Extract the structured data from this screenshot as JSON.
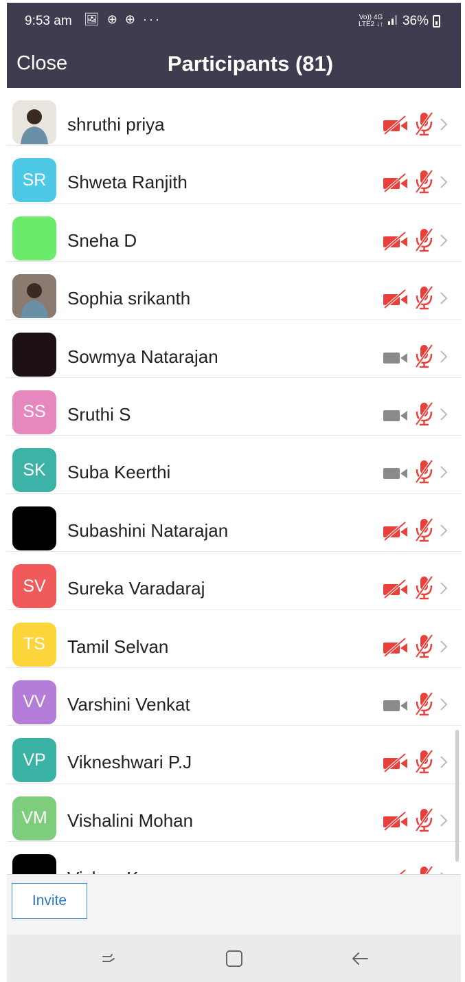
{
  "status_bar": {
    "time": "9:53 am",
    "left_icons": "🖼 ⊕ ⊕ ···",
    "network_top": "Vo)) 4G",
    "network_bottom": "LTE2 ↓↑",
    "battery": "36%"
  },
  "header": {
    "close_label": "Close",
    "title": "Participants (81)"
  },
  "colors": {
    "header_bg": "#3d3d4f",
    "muted_red": "#e8413c",
    "video_on_gray": "#8a8a8a",
    "invite_blue": "#2b73c3"
  },
  "participants": [
    {
      "name": "shruthi priya",
      "initials": "",
      "avatar_color": "#e9e6e0",
      "photo": true,
      "video": "off",
      "audio": "muted"
    },
    {
      "name": "Shweta Ranjith",
      "initials": "SR",
      "avatar_color": "#4ec9e5",
      "video": "off",
      "audio": "muted"
    },
    {
      "name": "Sneha D",
      "initials": "",
      "avatar_color": "#6cea6c",
      "video": "off",
      "audio": "muted"
    },
    {
      "name": "Sophia srikanth",
      "initials": "",
      "avatar_color": "#8a7a70",
      "photo": true,
      "video": "off",
      "audio": "muted"
    },
    {
      "name": "Sowmya Natarajan",
      "initials": "",
      "avatar_color": "#1c1016",
      "video": "on",
      "audio": "muted"
    },
    {
      "name": "Sruthi S",
      "initials": "SS",
      "avatar_color": "#e688bd",
      "video": "on",
      "audio": "muted"
    },
    {
      "name": "Suba Keerthi",
      "initials": "SK",
      "avatar_color": "#3db3a8",
      "video": "on",
      "audio": "muted"
    },
    {
      "name": "Subashini Natarajan",
      "initials": "",
      "avatar_color": "#000000",
      "video": "off",
      "audio": "muted"
    },
    {
      "name": "Sureka Varadaraj",
      "initials": "SV",
      "avatar_color": "#f05a5a",
      "video": "off",
      "audio": "muted"
    },
    {
      "name": "Tamil Selvan",
      "initials": "TS",
      "avatar_color": "#fcd53a",
      "video": "off",
      "audio": "muted"
    },
    {
      "name": "Varshini Venkat",
      "initials": "VV",
      "avatar_color": "#b47ed8",
      "video": "on",
      "audio": "muted"
    },
    {
      "name": "Vikneshwari P.J",
      "initials": "VP",
      "avatar_color": "#3bb3a4",
      "video": "off",
      "audio": "muted"
    },
    {
      "name": "Vishalini Mohan",
      "initials": "VM",
      "avatar_color": "#7dcd7d",
      "video": "off",
      "audio": "muted"
    },
    {
      "name": "Vishnu Kumar",
      "initials": "",
      "avatar_color": "#000000",
      "video": "off",
      "audio": "muted"
    }
  ],
  "footer": {
    "invite_label": "Invite"
  }
}
